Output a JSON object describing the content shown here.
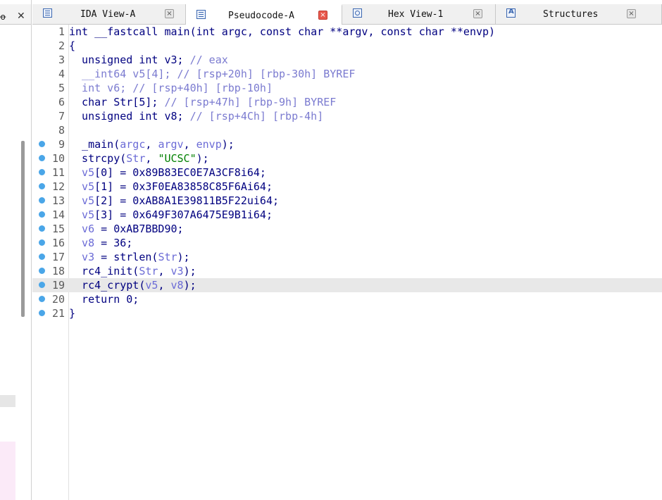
{
  "left_panel": {
    "tab_glyph": "ꝋ",
    "close_glyph": "✕"
  },
  "tabs": [
    {
      "label": "IDA View-A",
      "icon": "ida-view-icon",
      "active": false
    },
    {
      "label": "Pseudocode-A",
      "icon": "pseudocode-icon",
      "active": true
    },
    {
      "label": "Hex View-1",
      "icon": "hex-view-icon",
      "active": false
    },
    {
      "label": "Structures",
      "icon": "structures-icon",
      "active": false
    }
  ],
  "tab_close_glyph": "×",
  "colors": {
    "code_text": "#000080",
    "variable": "#6b6bd6",
    "comment": "#7b7bd0",
    "string": "#008000",
    "breakpoint_dot": "#4aa6e8",
    "highlight_line": "#e8e8e8"
  },
  "code": {
    "highlighted_line": 19,
    "lines": [
      {
        "n": "1",
        "bp": false,
        "tokens": [
          [
            "p",
            "int __fastcall main(int argc, const char **argv, const char **envp)"
          ]
        ]
      },
      {
        "n": "2",
        "bp": false,
        "tokens": [
          [
            "p",
            "{"
          ]
        ]
      },
      {
        "n": "3",
        "bp": false,
        "tokens": [
          [
            "p",
            "  unsigned int v3; "
          ],
          [
            "c",
            "// eax"
          ]
        ]
      },
      {
        "n": "4",
        "bp": false,
        "tokens": [
          [
            "c",
            "  __int64 v5[4]; // [rsp+20h] [rbp-30h] BYREF"
          ]
        ]
      },
      {
        "n": "5",
        "bp": false,
        "tokens": [
          [
            "c",
            "  int v6; // [rsp+40h] [rbp-10h]"
          ]
        ]
      },
      {
        "n": "6",
        "bp": false,
        "tokens": [
          [
            "p",
            "  char Str[5]; "
          ],
          [
            "c",
            "// [rsp+47h] [rbp-9h] BYREF"
          ]
        ]
      },
      {
        "n": "7",
        "bp": false,
        "tokens": [
          [
            "p",
            "  unsigned int v8; "
          ],
          [
            "c",
            "// [rsp+4Ch] [rbp-4h]"
          ]
        ]
      },
      {
        "n": "8",
        "bp": false,
        "tokens": [
          [
            "p",
            ""
          ]
        ]
      },
      {
        "n": "9",
        "bp": true,
        "tokens": [
          [
            "p",
            "  _main("
          ],
          [
            "v",
            "argc"
          ],
          [
            "p",
            ", "
          ],
          [
            "v",
            "argv"
          ],
          [
            "p",
            ", "
          ],
          [
            "v",
            "envp"
          ],
          [
            "p",
            ");"
          ]
        ]
      },
      {
        "n": "10",
        "bp": true,
        "tokens": [
          [
            "p",
            "  strcpy("
          ],
          [
            "v",
            "Str"
          ],
          [
            "p",
            ", "
          ],
          [
            "s",
            "\"UCSC\""
          ],
          [
            "p",
            ");"
          ]
        ]
      },
      {
        "n": "11",
        "bp": true,
        "tokens": [
          [
            "v",
            "  v5"
          ],
          [
            "p",
            "[0] = 0x89B83EC0E7A3CF8i64;"
          ]
        ]
      },
      {
        "n": "12",
        "bp": true,
        "tokens": [
          [
            "v",
            "  v5"
          ],
          [
            "p",
            "[1] = 0x3F0EA83858C85F6Ai64;"
          ]
        ]
      },
      {
        "n": "13",
        "bp": true,
        "tokens": [
          [
            "v",
            "  v5"
          ],
          [
            "p",
            "[2] = 0xAB8A1E39811B5F22ui64;"
          ]
        ]
      },
      {
        "n": "14",
        "bp": true,
        "tokens": [
          [
            "v",
            "  v5"
          ],
          [
            "p",
            "[3] = 0x649F307A6475E9B1i64;"
          ]
        ]
      },
      {
        "n": "15",
        "bp": true,
        "tokens": [
          [
            "v",
            "  v6"
          ],
          [
            "p",
            " = 0xAB7BBD90;"
          ]
        ]
      },
      {
        "n": "16",
        "bp": true,
        "tokens": [
          [
            "v",
            "  v8"
          ],
          [
            "p",
            " = 36;"
          ]
        ]
      },
      {
        "n": "17",
        "bp": true,
        "tokens": [
          [
            "v",
            "  v3"
          ],
          [
            "p",
            " = strlen("
          ],
          [
            "v",
            "Str"
          ],
          [
            "p",
            ");"
          ]
        ]
      },
      {
        "n": "18",
        "bp": true,
        "tokens": [
          [
            "p",
            "  rc4_init("
          ],
          [
            "v",
            "Str"
          ],
          [
            "p",
            ", "
          ],
          [
            "v",
            "v3"
          ],
          [
            "p",
            ");"
          ]
        ]
      },
      {
        "n": "19",
        "bp": true,
        "tokens": [
          [
            "p",
            "  rc4_crypt("
          ],
          [
            "v",
            "v5"
          ],
          [
            "p",
            ", "
          ],
          [
            "v",
            "v8"
          ],
          [
            "p",
            ");"
          ]
        ]
      },
      {
        "n": "20",
        "bp": true,
        "tokens": [
          [
            "p",
            "  return 0;"
          ]
        ]
      },
      {
        "n": "21",
        "bp": true,
        "tokens": [
          [
            "p",
            "}"
          ]
        ]
      }
    ]
  }
}
